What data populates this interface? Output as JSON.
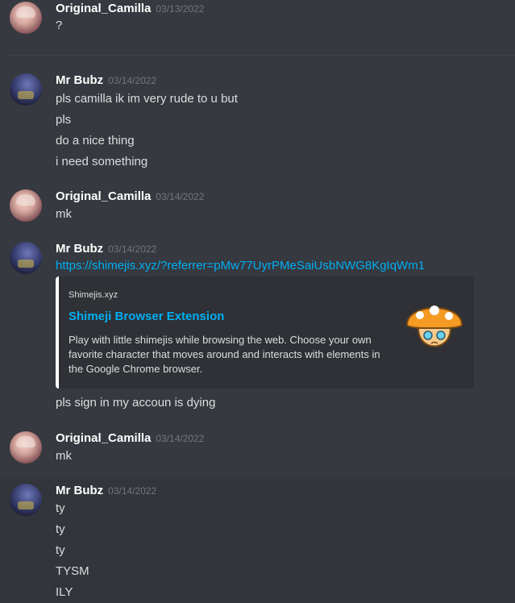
{
  "messages": [
    {
      "user": "Original_Camilla",
      "time": "03/13/2022",
      "lines": [
        "?"
      ]
    },
    {
      "user": "Mr Bubz",
      "time": "03/14/2022",
      "lines": [
        "pls camilla ik im very rude to u but",
        "pls",
        "do a nice thing",
        "i need something"
      ]
    },
    {
      "user": "Original_Camilla",
      "time": "03/14/2022",
      "lines": [
        "mk"
      ]
    },
    {
      "user": "Mr Bubz",
      "time": "03/14/2022",
      "link": "https://shimejis.xyz/?referrer=pMw77UyrPMeSaiUsbNWG8KgIqWm1",
      "after_embed": "pls sign in my accoun is dying"
    },
    {
      "user": "Original_Camilla",
      "time": "03/14/2022",
      "lines": [
        "mk"
      ]
    },
    {
      "user": "Mr Bubz",
      "time": "03/14/2022",
      "lines": [
        "ty",
        "ty",
        "ty",
        "TYSM",
        "ILY"
      ]
    }
  ],
  "embed": {
    "provider": "Shimejis.xyz",
    "title": "Shimeji Browser Extension",
    "description": "Play with little shimejis while browsing the web. Choose your own favorite character that moves around and interacts with elements in the Google Chrome browser."
  },
  "colors": {
    "background": "#36393f",
    "link": "#00aff4",
    "embed_bg": "#2f3136"
  }
}
